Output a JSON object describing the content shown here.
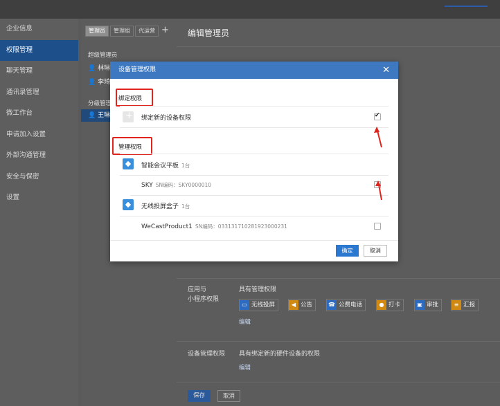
{
  "sidebar": {
    "items": [
      {
        "label": "企业信息"
      },
      {
        "label": "权限管理"
      },
      {
        "label": "聊天管理"
      },
      {
        "label": "通讯录管理"
      },
      {
        "label": "微工作台"
      },
      {
        "label": "申请加入设置"
      },
      {
        "label": "外部沟通管理"
      },
      {
        "label": "安全与保密"
      },
      {
        "label": "设置"
      }
    ]
  },
  "midpanel": {
    "tabs": [
      "管理员",
      "管理组",
      "代运营"
    ],
    "add": "+",
    "super_label": "超级管理员",
    "super_entries": [
      "林琳",
      "李琦"
    ],
    "sub_label": "分级管理员",
    "sub_entries": [
      "王琳"
    ]
  },
  "main": {
    "title": "编辑管理员",
    "apps_label_1": "应用与",
    "apps_label_2": "小程序权限",
    "apps_value": "具有管理权限",
    "apps": [
      {
        "label": "无线投屏"
      },
      {
        "label": "公告"
      },
      {
        "label": "公费电话"
      },
      {
        "label": "打卡"
      },
      {
        "label": "审批"
      },
      {
        "label": "汇报"
      }
    ],
    "edit_1": "编辑",
    "device_label": "设备管理权限",
    "device_value": "具有绑定新的硬件设备的权限",
    "edit_2": "编辑",
    "save": "保存",
    "cancel": "取消"
  },
  "modal": {
    "title": "设备管理权限",
    "close": "✕",
    "bind_section": "绑定权限",
    "bind_item": "绑定新的设备权限",
    "manage_section": "管理权限",
    "groups": [
      {
        "name": "智能会议平板",
        "count": "1台",
        "device": "SKY",
        "sn": "SN编码：SKY0000010",
        "checked": false
      },
      {
        "name": "无线投屏盒子",
        "count": "1台",
        "device": "WeCastProduct1",
        "sn": "SN编码：033131710281923000231",
        "checked": false
      }
    ],
    "ok": "确定",
    "cancel": "取消"
  }
}
